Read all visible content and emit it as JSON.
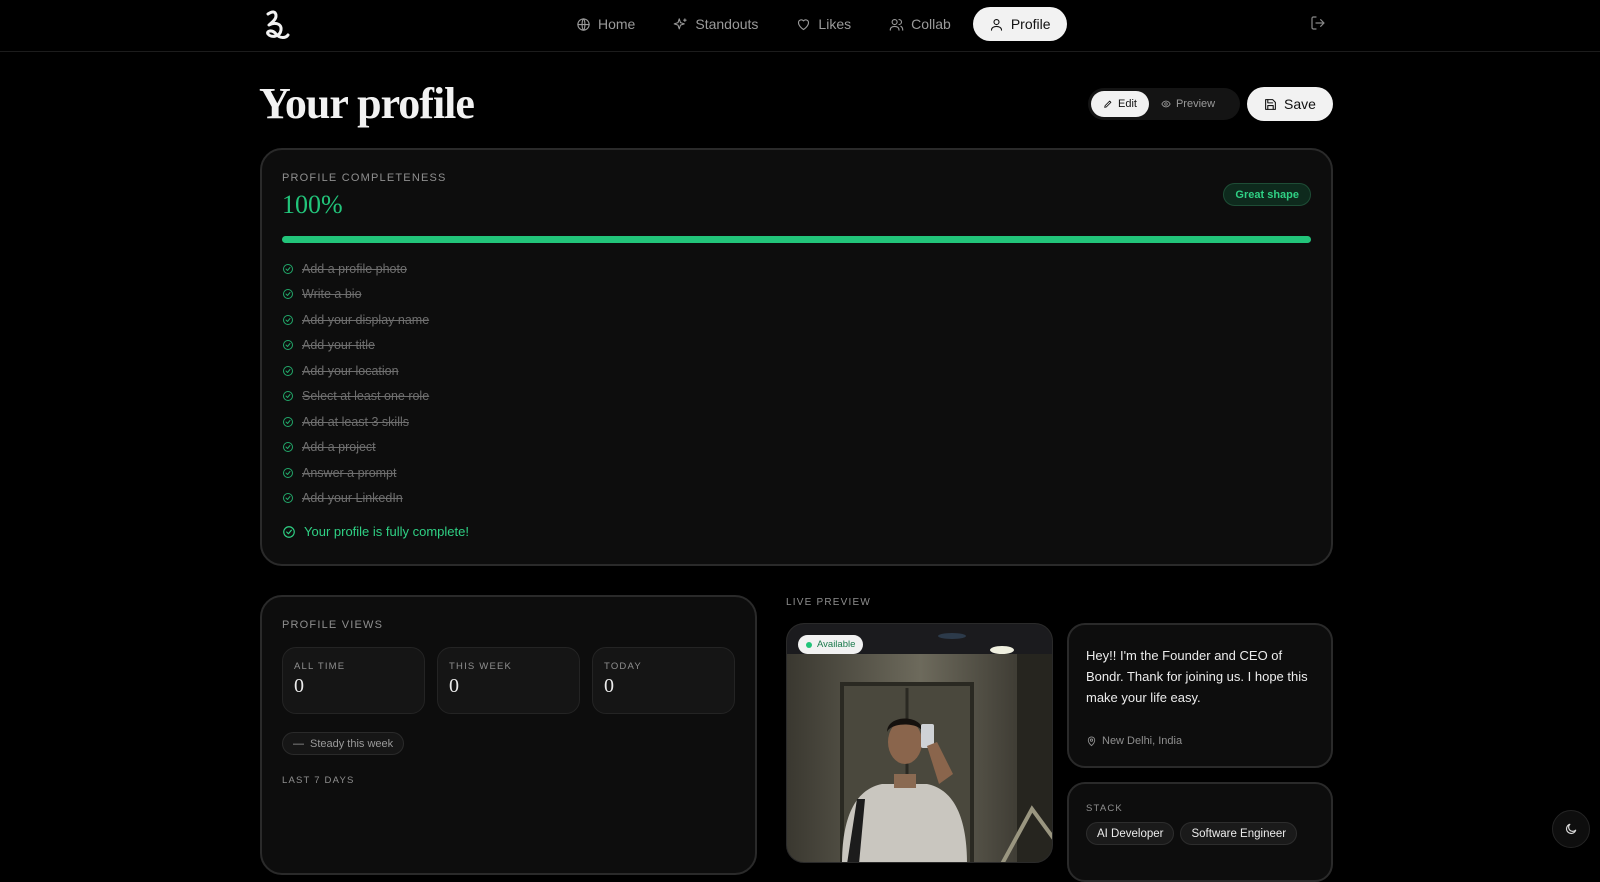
{
  "header": {
    "logo_icon": "brand-logo-icon",
    "nav": [
      {
        "label": "Home",
        "icon": "globe-icon"
      },
      {
        "label": "Standouts",
        "icon": "sparkles-icon"
      },
      {
        "label": "Likes",
        "icon": "heart-icon"
      },
      {
        "label": "Collab",
        "icon": "users-icon"
      },
      {
        "label": "Profile",
        "icon": "user-icon",
        "active": true
      }
    ],
    "logout_icon": "logout-icon"
  },
  "page": {
    "title": "Your profile",
    "mode": {
      "edit": "Edit",
      "preview": "Preview",
      "active": "Edit"
    },
    "save_label": "Save"
  },
  "completeness": {
    "label": "PROFILE COMPLETENESS",
    "percent_text": "100%",
    "percent_value": 1.0,
    "badge": "Great shape",
    "checklist": [
      "Add a profile photo",
      "Write a bio",
      "Add your display name",
      "Add your title",
      "Add your location",
      "Select at least one role",
      "Add at least 3 skills",
      "Add a project",
      "Answer a prompt",
      "Add your LinkedIn"
    ],
    "complete_message": "Your profile is fully complete!"
  },
  "views": {
    "label": "PROFILE VIEWS",
    "stats": [
      {
        "label": "ALL TIME",
        "value": "0"
      },
      {
        "label": "THIS WEEK",
        "value": "0"
      },
      {
        "label": "TODAY",
        "value": "0"
      }
    ],
    "trend": "Steady this week",
    "last7_label": "LAST 7 DAYS"
  },
  "preview": {
    "label": "LIVE PREVIEW",
    "availability": "Available",
    "bio": "Hey!! I'm the Founder and CEO of Bondr. Thank for joining us. I hope this make your life easy.",
    "location": "New Delhi, India",
    "stack_label": "STACK",
    "stack": [
      "AI Developer",
      "Software Engineer"
    ]
  },
  "colors": {
    "accent": "#22c47a",
    "background": "#000000",
    "card": "#0d0d0d"
  }
}
